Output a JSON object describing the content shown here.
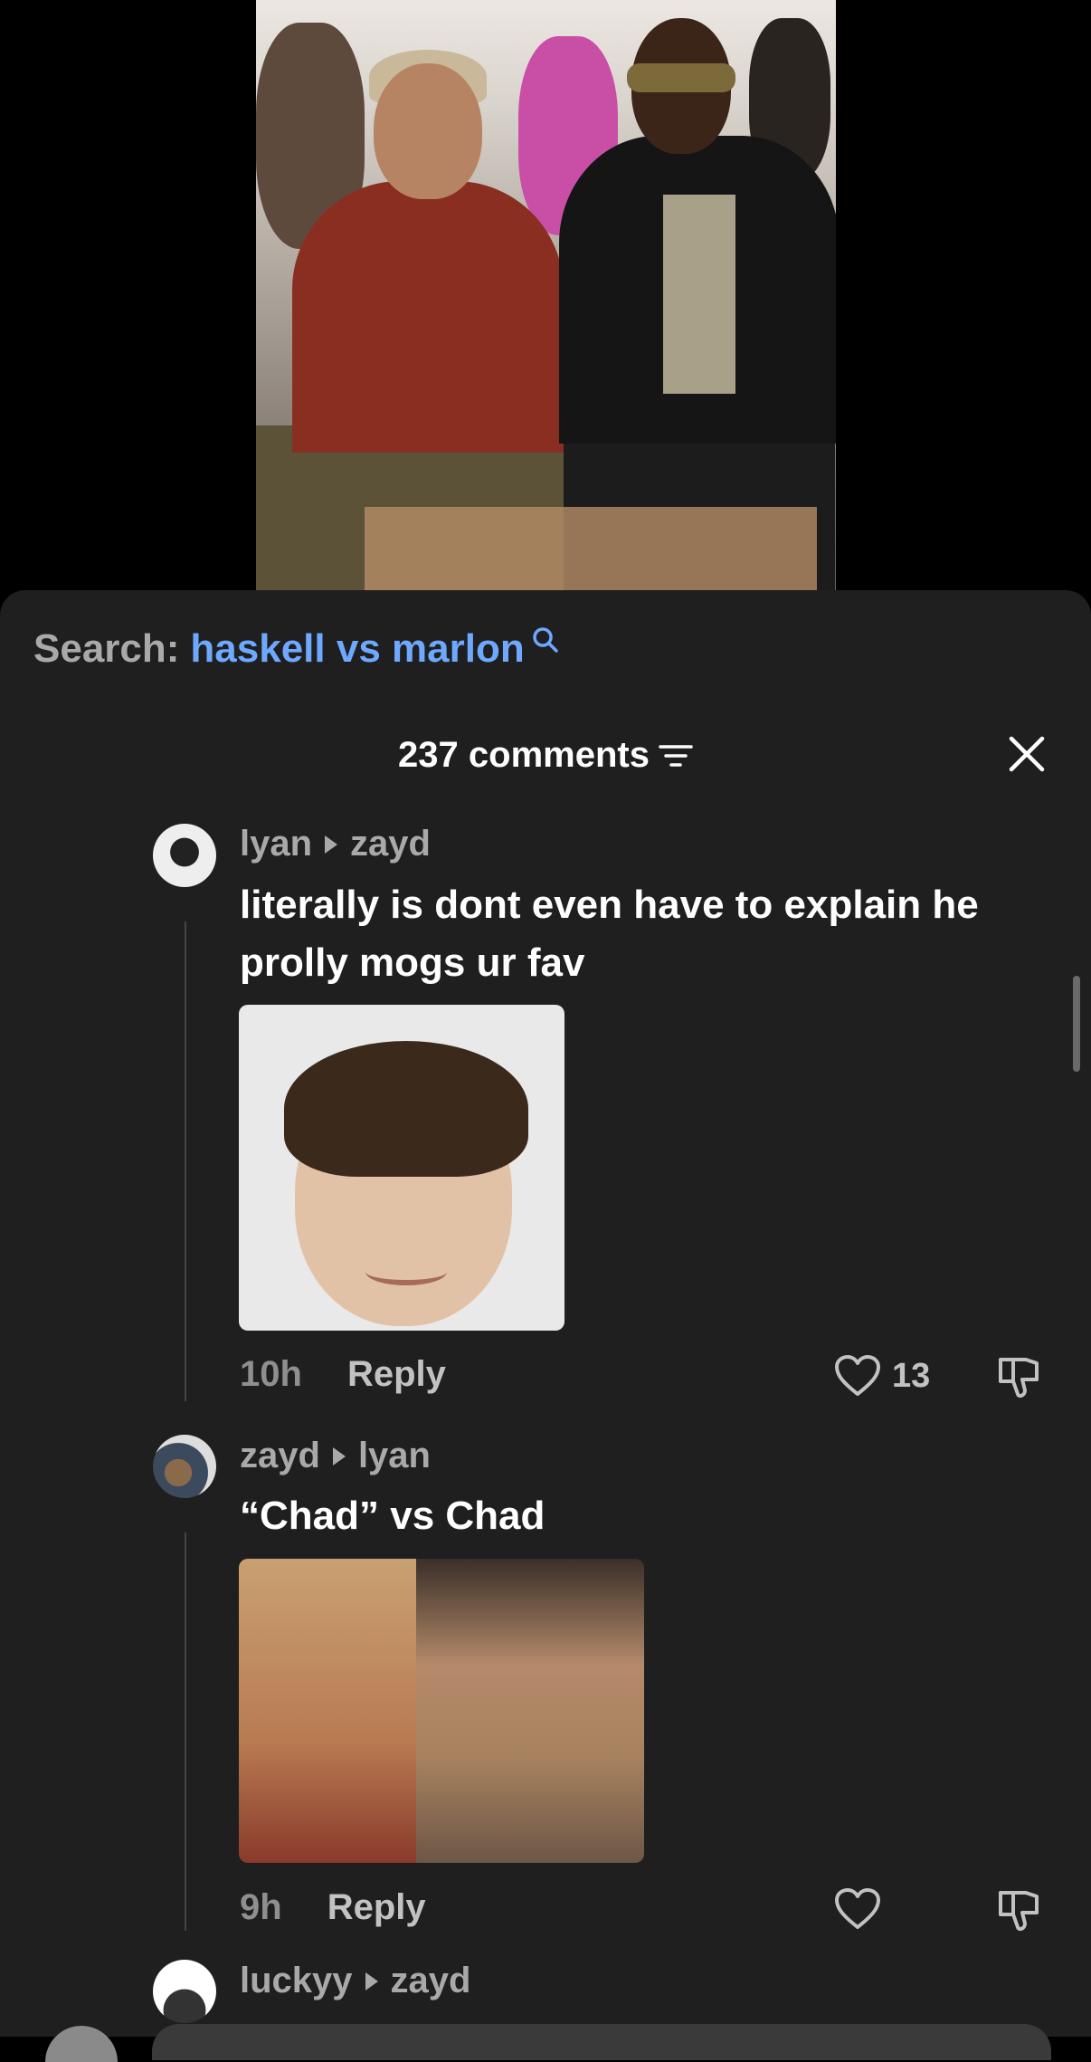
{
  "search": {
    "label": "Search:",
    "term": "haskell vs marlon"
  },
  "header": {
    "comment_count": "237 comments"
  },
  "comments": [
    {
      "author": "lyan",
      "reply_to": "zayd",
      "text_line1": "literally is dont even have to explain he",
      "text_line2": "prolly mogs ur fav",
      "time": "10h",
      "reply_label": "Reply",
      "likes": "13"
    },
    {
      "author": "zayd",
      "reply_to": "lyan",
      "text": "“Chad” vs Chad",
      "time": "9h",
      "reply_label": "Reply",
      "likes": ""
    },
    {
      "author": "luckyy",
      "reply_to": "zayd"
    }
  ],
  "colors": {
    "sheet_bg": "#1f1f1f",
    "search_accent": "#6ea8ff",
    "muted_text": "#a9a9a9"
  }
}
